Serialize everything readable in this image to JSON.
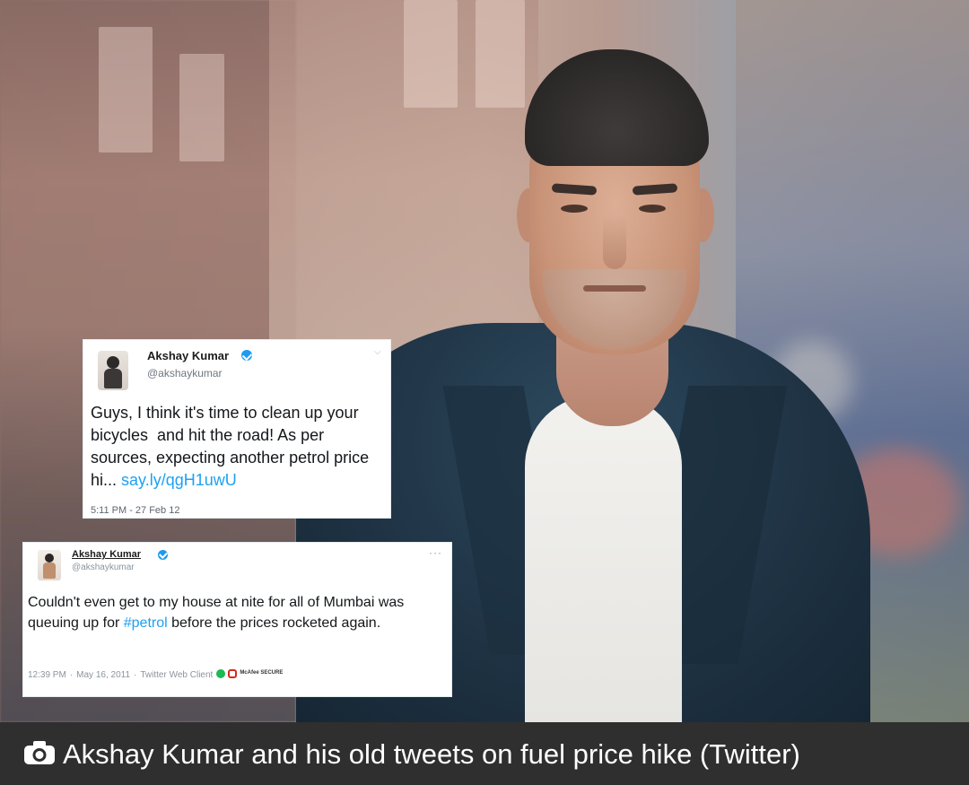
{
  "tweet_top": {
    "name": "Akshay Kumar",
    "handle": "@akshaykumar",
    "text": "Guys, I think it's time to clean up your bicycles  and hit the road! As per sources, expecting another petrol price hi...",
    "link": "say.ly/qgH1uwU",
    "timestamp": "5:11 PM - 27 Feb 12"
  },
  "tweet_bottom": {
    "name": "Akshay Kumar",
    "handle": "@akshaykumar",
    "text_before_hashtag": "Couldn't even get to my house at nite for all of Mumbai was queuing up for ",
    "hashtag": "#petrol",
    "text_after_hashtag": " before the prices rocketed again.",
    "time": "12:39 PM",
    "date": "May 16, 2011",
    "client": "Twitter Web Client",
    "security_label": "McAfee SECURE",
    "more_icon": "···"
  },
  "caption": {
    "text": "Akshay Kumar and his old tweets on fuel price hike (Twitter)"
  },
  "colors": {
    "link": "#1da1f2",
    "verified": "#1d9bf0",
    "caption_bg": "#2f2f2f"
  },
  "icons": [
    "camera-icon",
    "verified-badge-icon",
    "chevron-down-icon",
    "more-icon"
  ]
}
